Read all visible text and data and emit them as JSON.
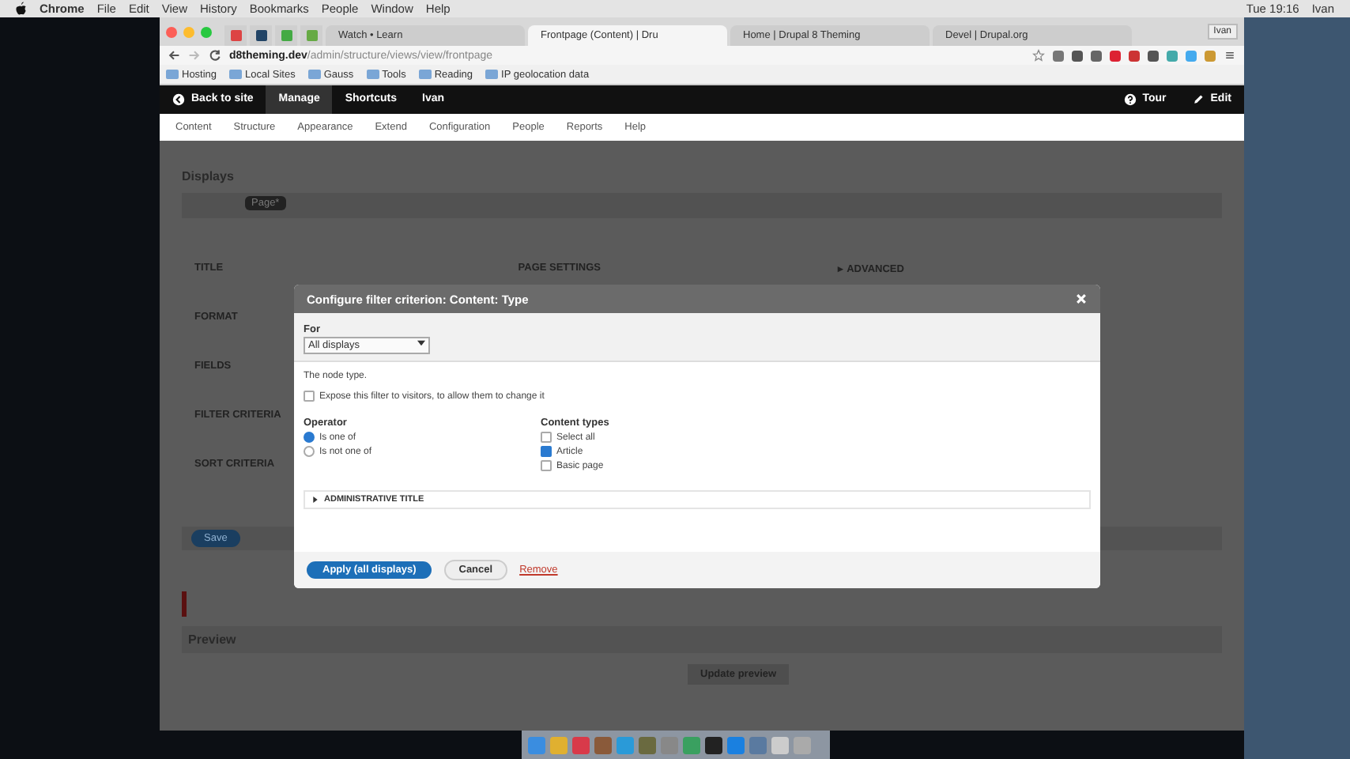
{
  "menubar": {
    "app": "Chrome",
    "menus": [
      "File",
      "Edit",
      "View",
      "History",
      "Bookmarks",
      "People",
      "Window",
      "Help"
    ],
    "clock": "Tue 19:16",
    "user": "Ivan"
  },
  "browser": {
    "tabs": [
      {
        "label": "Watch • Learn",
        "selected": false
      },
      {
        "label": "Frontpage (Content) | Dru",
        "selected": true
      },
      {
        "label": "Home | Drupal 8 Theming",
        "selected": false
      },
      {
        "label": "Devel | Drupal.org",
        "selected": false
      }
    ],
    "profile": "Ivan",
    "url_host": "d8theming.dev",
    "url_path": "/admin/structure/views/view/frontpage",
    "bookmarks": [
      "Hosting",
      "Local Sites",
      "Gauss",
      "Tools",
      "Reading",
      "IP geolocation data"
    ]
  },
  "toolbar": {
    "back": "Back to site",
    "items": [
      {
        "label": "Manage",
        "selected": true
      },
      {
        "label": "Shortcuts",
        "selected": false
      },
      {
        "label": "Ivan",
        "selected": false
      }
    ],
    "tour": "Tour",
    "edit": "Edit",
    "tray": [
      "Content",
      "Structure",
      "Appearance",
      "Extend",
      "Configuration",
      "People",
      "Reports",
      "Help"
    ]
  },
  "background": {
    "heading": "Displays",
    "display_tab": "Page*",
    "columns": [
      "TITLE",
      "PAGE SETTINGS",
      "▸ ADVANCED"
    ],
    "sections": [
      "FORMAT",
      "FIELDS",
      "FILTER CRITERIA",
      "SORT CRITERIA"
    ],
    "save": "Save",
    "preview": "Preview",
    "update_preview": "Update preview"
  },
  "dialog": {
    "title": "Configure filter criterion: Content: Type",
    "for_label": "For",
    "for_value": "All displays",
    "description": "The node type.",
    "expose": {
      "label": "Expose this filter to visitors, to allow them to change it",
      "checked": false
    },
    "operator": {
      "label": "Operator",
      "options": [
        {
          "label": "Is one of",
          "selected": true
        },
        {
          "label": "Is not one of",
          "selected": false
        }
      ]
    },
    "content_types": {
      "label": "Content types",
      "options": [
        {
          "label": "Select all",
          "checked": false
        },
        {
          "label": "Article",
          "checked": true
        },
        {
          "label": "Basic page",
          "checked": false
        }
      ]
    },
    "details": {
      "label": "ADMINISTRATIVE TITLE",
      "expanded": false
    },
    "apply": "Apply (all displays)",
    "cancel": "Cancel",
    "remove": "Remove"
  }
}
